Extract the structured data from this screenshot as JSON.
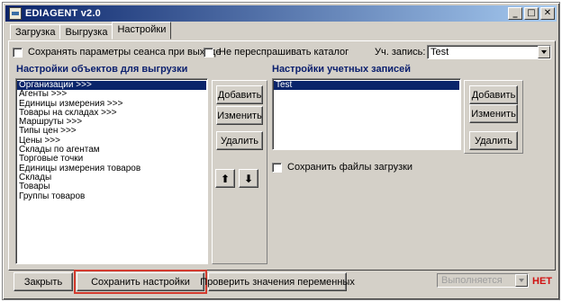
{
  "window": {
    "title": "EDIAGENT v2.0"
  },
  "tabs": [
    {
      "label": "Загрузка"
    },
    {
      "label": "Выгрузка"
    },
    {
      "label": "Настройки",
      "active": true
    }
  ],
  "options": {
    "save_session": {
      "label": "Сохранять параметры сеанса при выходе",
      "checked": false
    },
    "no_reask_catalog": {
      "label": "Не переспрашивать каталог",
      "checked": false
    },
    "account_label": "Уч. запись:",
    "account_value": "Test"
  },
  "export_objects": {
    "title": "Настройки объектов для выгрузки",
    "items": [
      "Организации >>>",
      "Агенты >>>",
      "Единицы измерения >>>",
      "Товары на складах >>>",
      "Маршруты >>>",
      "Типы цен >>>",
      "Цены >>>",
      "Склады по агентам",
      "Торговые точки",
      "Единицы измерения товаров",
      "Склады",
      "Товары",
      "Группы товаров"
    ],
    "selected_index": 0,
    "buttons": {
      "add": "Добавить",
      "edit": "Изменить",
      "delete": "Удалить",
      "up": "⬆",
      "down": "⬇"
    }
  },
  "accounts": {
    "title": "Настройки учетных записей",
    "items": [
      "Test"
    ],
    "selected_index": 0,
    "buttons": {
      "add": "Добавить",
      "edit": "Изменить",
      "delete": "Удалить"
    }
  },
  "save_download_files": {
    "label": "Сохранить файлы загрузки",
    "checked": false
  },
  "footer": {
    "close": "Закрыть",
    "save_settings": "Сохранить настройки",
    "check_vars": "Проверить значения переменных",
    "status_combo": "Выполняется",
    "status_text": "НЕТ"
  },
  "colors": {
    "window_bg": "#d4d0c8",
    "title_bar": "#0a246a",
    "section_title": "#0a1f6e",
    "selection": "#0a246a",
    "status_text": "#d01010",
    "highlight_outline": "#d23a2e"
  }
}
